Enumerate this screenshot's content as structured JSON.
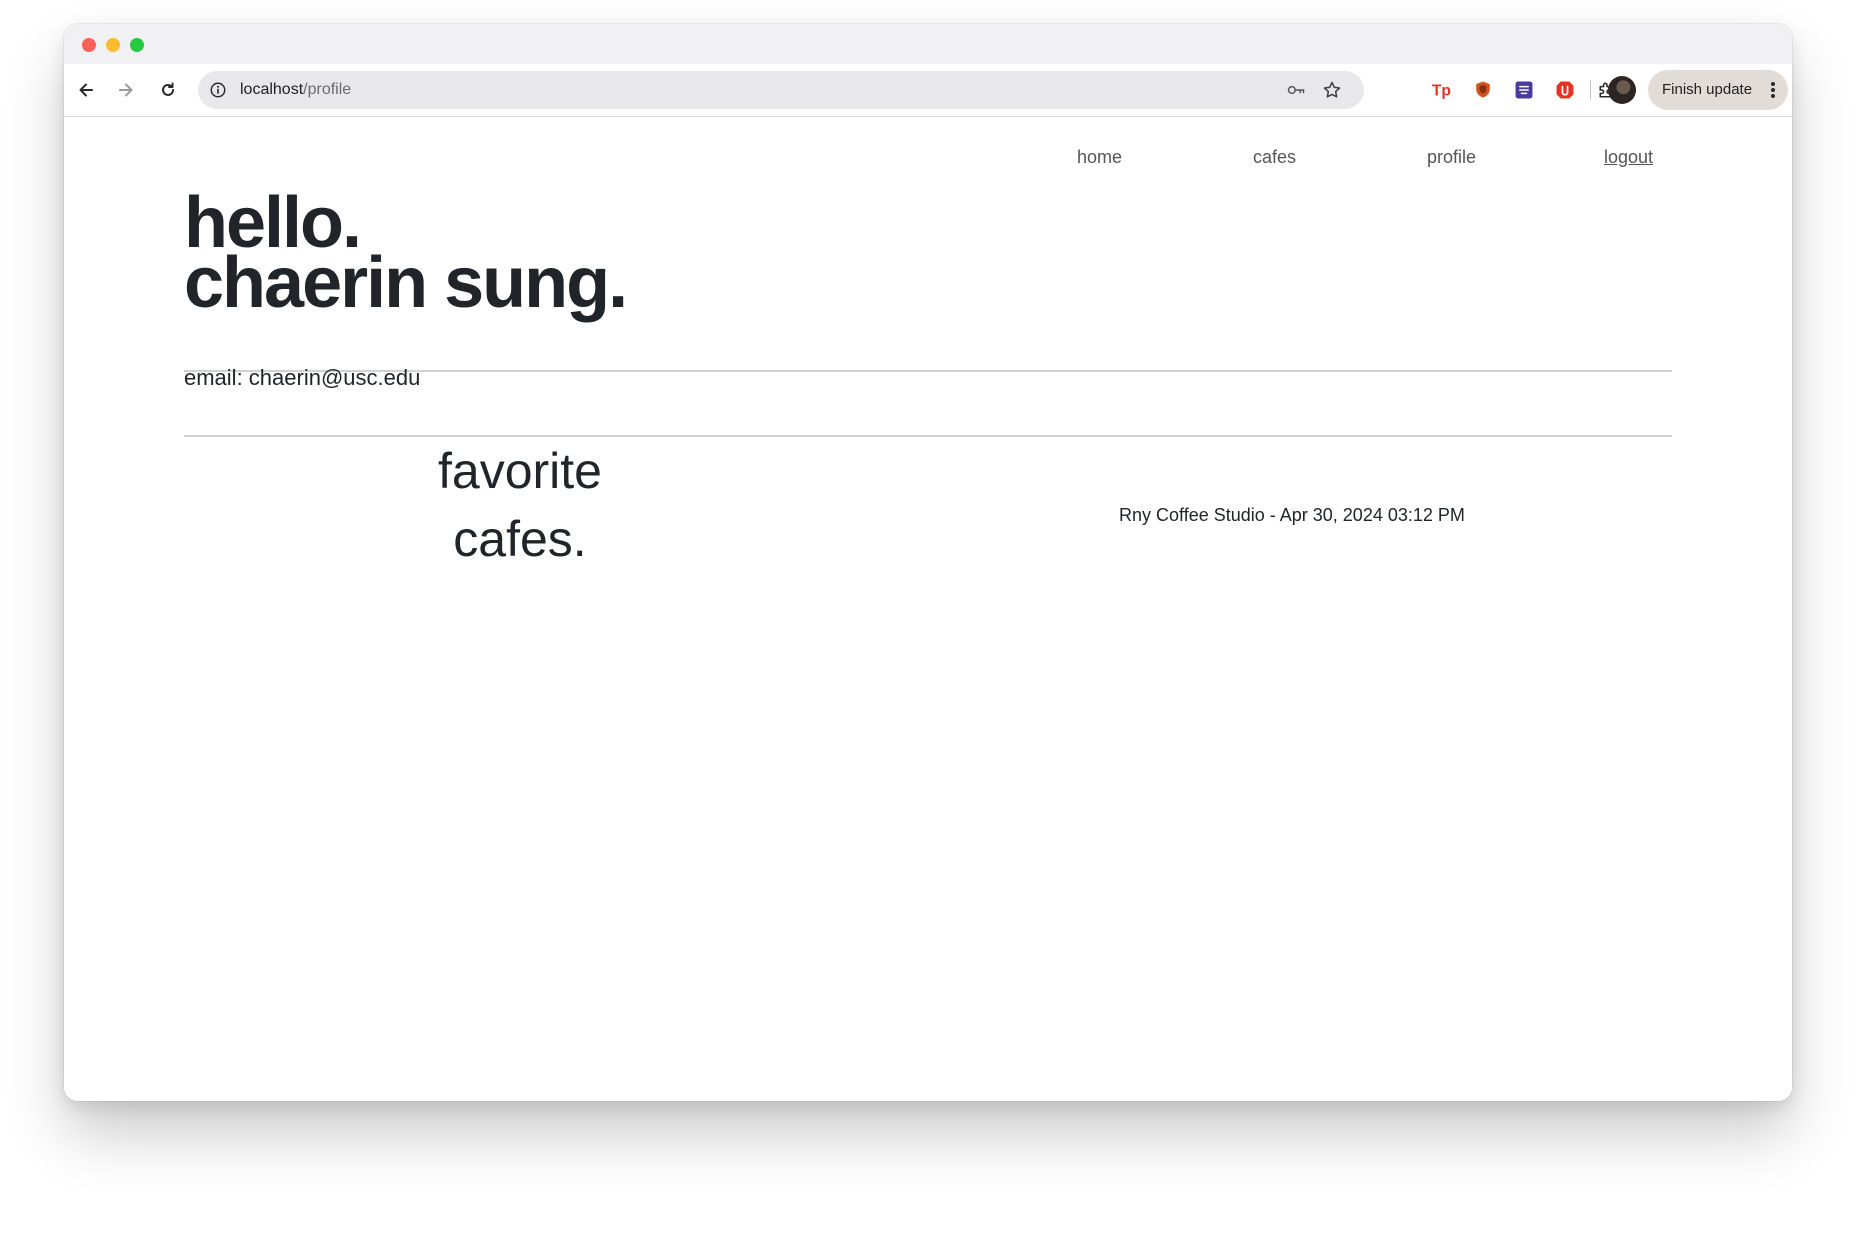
{
  "browser": {
    "url_host": "localhost",
    "url_path": "/profile",
    "finish_update_label": "Finish update",
    "icons": {
      "back": "arrow-left-icon",
      "forward": "arrow-right-icon",
      "reload": "reload-icon",
      "site_info": "info-icon",
      "password": "key-icon",
      "bookmark": "star-icon",
      "extensions": [
        "tp-extension-icon",
        "shield-extension-icon",
        "purple-extension-icon",
        "red-extension-icon",
        "puzzle-icon"
      ],
      "menu": "more-vertical-icon"
    }
  },
  "nav": {
    "home": "home",
    "cafes": "cafes",
    "profile": "profile",
    "logout": "logout"
  },
  "profile": {
    "greeting_line1": "hello.",
    "greeting_line2": "chaerin sung.",
    "email_line": "email: chaerin@usc.edu"
  },
  "favorites": {
    "title_line1": "favorite",
    "title_line2": "cafes.",
    "items": [
      "Rny Coffee Studio - Apr 30, 2024 03:12 PM"
    ]
  },
  "colors": {
    "text": "#212529",
    "nav_text": "#555555",
    "divider": "#d2d2d2",
    "close": "#ff5f57",
    "minimize": "#febc2e",
    "maximize": "#28c840"
  }
}
